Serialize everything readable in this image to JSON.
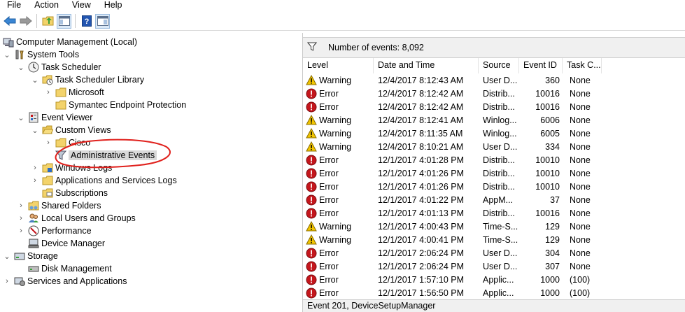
{
  "menu": [
    "File",
    "Action",
    "View",
    "Help"
  ],
  "toolbar": {
    "icons": [
      "back-arrow-icon",
      "forward-arrow-icon",
      "up-folder-icon",
      "show-hide-tree-icon",
      "help-icon",
      "properties-pane-icon"
    ]
  },
  "tree": {
    "root": "Computer Management (Local)",
    "system_tools": "System Tools",
    "task_scheduler": "Task Scheduler",
    "task_scheduler_library": "Task Scheduler Library",
    "microsoft": "Microsoft",
    "symantec": "Symantec Endpoint Protection",
    "event_viewer": "Event Viewer",
    "custom_views": "Custom Views",
    "cisco": "Cisco",
    "administrative_events": "Administrative Events",
    "windows_logs": "Windows Logs",
    "app_services_logs": "Applications and Services Logs",
    "subscriptions": "Subscriptions",
    "shared_folders": "Shared Folders",
    "local_users_groups": "Local Users and Groups",
    "performance": "Performance",
    "device_manager": "Device Manager",
    "storage": "Storage",
    "disk_management": "Disk Management",
    "services_apps": "Services and Applications"
  },
  "events": {
    "count_label": "Number of events: 8,092",
    "columns": [
      "Level",
      "Date and Time",
      "Source",
      "Event ID",
      "Task C..."
    ],
    "rows": [
      {
        "level": "Warning",
        "date": "12/4/2017 8:12:43 AM",
        "source": "User D...",
        "id": "360",
        "task": "None"
      },
      {
        "level": "Error",
        "date": "12/4/2017 8:12:42 AM",
        "source": "Distrib...",
        "id": "10016",
        "task": "None"
      },
      {
        "level": "Error",
        "date": "12/4/2017 8:12:42 AM",
        "source": "Distrib...",
        "id": "10016",
        "task": "None"
      },
      {
        "level": "Warning",
        "date": "12/4/2017 8:12:41 AM",
        "source": "Winlog...",
        "id": "6006",
        "task": "None"
      },
      {
        "level": "Warning",
        "date": "12/4/2017 8:11:35 AM",
        "source": "Winlog...",
        "id": "6005",
        "task": "None"
      },
      {
        "level": "Warning",
        "date": "12/4/2017 8:10:21 AM",
        "source": "User D...",
        "id": "334",
        "task": "None"
      },
      {
        "level": "Error",
        "date": "12/1/2017 4:01:28 PM",
        "source": "Distrib...",
        "id": "10010",
        "task": "None"
      },
      {
        "level": "Error",
        "date": "12/1/2017 4:01:26 PM",
        "source": "Distrib...",
        "id": "10010",
        "task": "None"
      },
      {
        "level": "Error",
        "date": "12/1/2017 4:01:26 PM",
        "source": "Distrib...",
        "id": "10010",
        "task": "None"
      },
      {
        "level": "Error",
        "date": "12/1/2017 4:01:22 PM",
        "source": "AppM...",
        "id": "37",
        "task": "None"
      },
      {
        "level": "Error",
        "date": "12/1/2017 4:01:13 PM",
        "source": "Distrib...",
        "id": "10016",
        "task": "None"
      },
      {
        "level": "Warning",
        "date": "12/1/2017 4:00:43 PM",
        "source": "Time-S...",
        "id": "129",
        "task": "None"
      },
      {
        "level": "Warning",
        "date": "12/1/2017 4:00:41 PM",
        "source": "Time-S...",
        "id": "129",
        "task": "None"
      },
      {
        "level": "Error",
        "date": "12/1/2017 2:06:24 PM",
        "source": "User D...",
        "id": "304",
        "task": "None"
      },
      {
        "level": "Error",
        "date": "12/1/2017 2:06:24 PM",
        "source": "User D...",
        "id": "307",
        "task": "None"
      },
      {
        "level": "Error",
        "date": "12/1/2017 1:57:10 PM",
        "source": "Applic...",
        "id": "1000",
        "task": "(100)"
      },
      {
        "level": "Error",
        "date": "12/1/2017 1:56:50 PM",
        "source": "Applic...",
        "id": "1000",
        "task": "(100)"
      }
    ],
    "status": "Event 201, DeviceSetupManager"
  },
  "colors": {
    "warning": "#f2c500",
    "error": "#c4161c",
    "annotation": "#e0201c",
    "selection": "#d9d9d9"
  }
}
